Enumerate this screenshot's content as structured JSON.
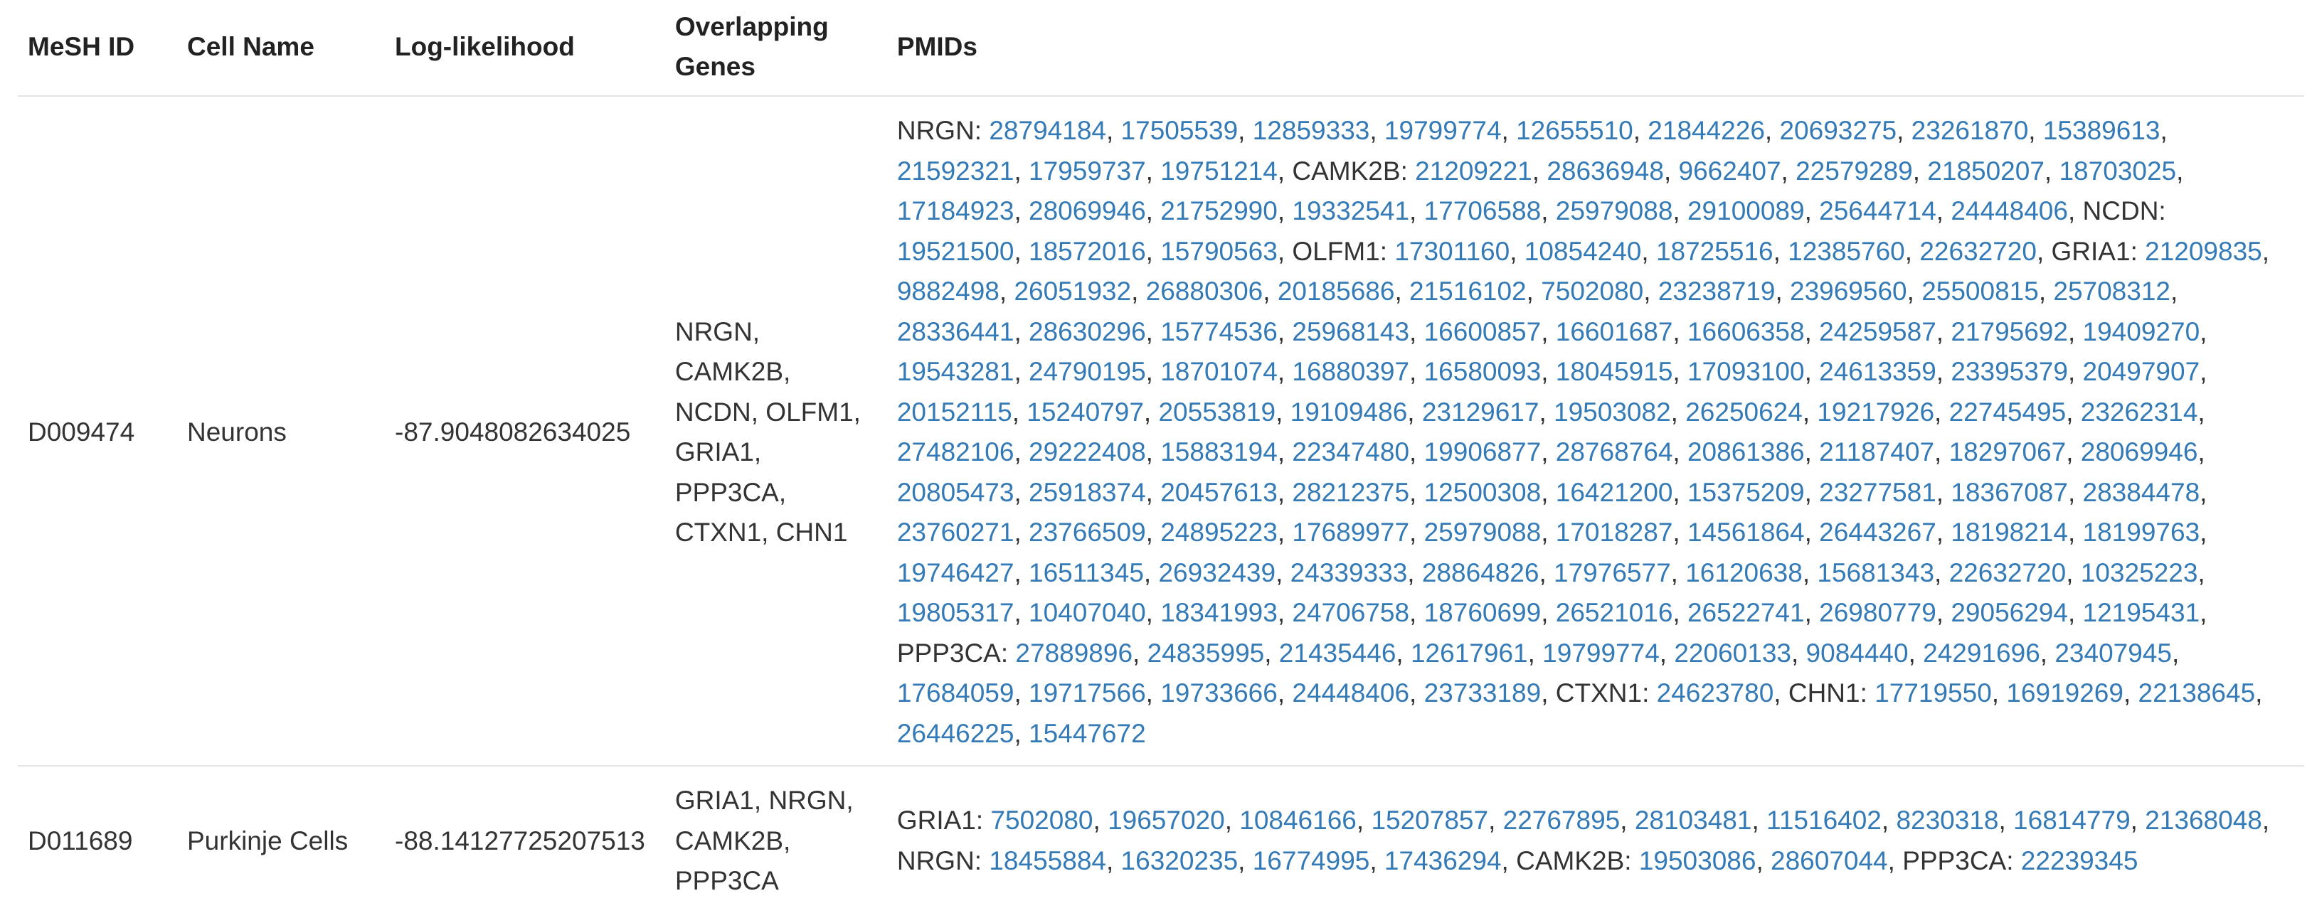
{
  "table": {
    "headers": {
      "mesh_id": "MeSH ID",
      "cell_name": "Cell Name",
      "log_likelihood": "Log-likelihood",
      "overlapping_genes": "Overlapping Genes",
      "pmids": "PMIDs"
    },
    "rows": [
      {
        "mesh_id": "D009474",
        "cell_name": "Neurons",
        "log_likelihood": "-87.9048082634025",
        "overlapping_genes": "NRGN, CAMK2B, NCDN, OLFM1, GRIA1, PPP3CA, CTXN1, CHN1",
        "pmid_groups": [
          {
            "gene": "NRGN",
            "pmids": [
              "28794184",
              "17505539",
              "12859333",
              "19799774",
              "12655510",
              "21844226",
              "20693275",
              "23261870",
              "15389613",
              "21592321",
              "17959737",
              "19751214"
            ]
          },
          {
            "gene": "CAMK2B",
            "pmids": [
              "21209221",
              "28636948",
              "9662407",
              "22579289",
              "21850207",
              "18703025",
              "17184923",
              "28069946",
              "21752990",
              "19332541",
              "17706588",
              "25979088",
              "29100089",
              "25644714",
              "24448406"
            ]
          },
          {
            "gene": "NCDN",
            "pmids": [
              "19521500",
              "18572016",
              "15790563"
            ]
          },
          {
            "gene": "OLFM1",
            "pmids": [
              "17301160",
              "10854240",
              "18725516",
              "12385760",
              "22632720"
            ]
          },
          {
            "gene": "GRIA1",
            "pmids": [
              "21209835",
              "9882498",
              "26051932",
              "26880306",
              "20185686",
              "21516102",
              "7502080",
              "23238719",
              "23969560",
              "25500815",
              "25708312",
              "28336441",
              "28630296",
              "15774536",
              "25968143",
              "16600857",
              "16601687",
              "16606358",
              "24259587",
              "21795692",
              "19409270",
              "19543281",
              "24790195",
              "18701074",
              "16880397",
              "16580093",
              "18045915",
              "17093100",
              "24613359",
              "23395379",
              "20497907",
              "20152115",
              "15240797",
              "20553819",
              "19109486",
              "23129617",
              "19503082",
              "26250624",
              "19217926",
              "22745495",
              "23262314",
              "27482106",
              "29222408",
              "15883194",
              "22347480",
              "19906877",
              "28768764",
              "20861386",
              "21187407",
              "18297067",
              "28069946",
              "20805473",
              "25918374",
              "20457613",
              "28212375",
              "12500308",
              "16421200",
              "15375209",
              "23277581",
              "18367087",
              "28384478",
              "23760271",
              "23766509",
              "24895223",
              "17689977",
              "25979088",
              "17018287",
              "14561864",
              "26443267",
              "18198214",
              "18199763",
              "19746427",
              "16511345",
              "26932439",
              "24339333",
              "28864826",
              "17976577",
              "16120638",
              "15681343",
              "22632720",
              "10325223",
              "19805317",
              "10407040",
              "18341993",
              "24706758",
              "18760699",
              "26521016",
              "26522741",
              "26980779",
              "29056294",
              "12195431"
            ]
          },
          {
            "gene": "PPP3CA",
            "pmids": [
              "27889896",
              "24835995",
              "21435446",
              "12617961",
              "19799774",
              "22060133",
              "9084440",
              "24291696",
              "23407945",
              "17684059",
              "19717566",
              "19733666",
              "24448406",
              "23733189"
            ]
          },
          {
            "gene": "CTXN1",
            "pmids": [
              "24623780"
            ]
          },
          {
            "gene": "CHN1",
            "pmids": [
              "17719550",
              "16919269",
              "22138645",
              "26446225",
              "15447672"
            ]
          }
        ]
      },
      {
        "mesh_id": "D011689",
        "cell_name": "Purkinje Cells",
        "log_likelihood": "-88.14127725207513",
        "overlapping_genes": "GRIA1, NRGN, CAMK2B, PPP3CA",
        "pmid_groups": [
          {
            "gene": "GRIA1",
            "pmids": [
              "7502080",
              "19657020",
              "10846166",
              "15207857",
              "22767895",
              "28103481",
              "11516402",
              "8230318",
              "16814779",
              "21368048"
            ]
          },
          {
            "gene": "NRGN",
            "pmids": [
              "18455884",
              "16320235",
              "16774995",
              "17436294"
            ]
          },
          {
            "gene": "CAMK2B",
            "pmids": [
              "19503086",
              "28607044"
            ]
          },
          {
            "gene": "PPP3CA",
            "pmids": [
              "22239345"
            ]
          }
        ]
      }
    ]
  }
}
